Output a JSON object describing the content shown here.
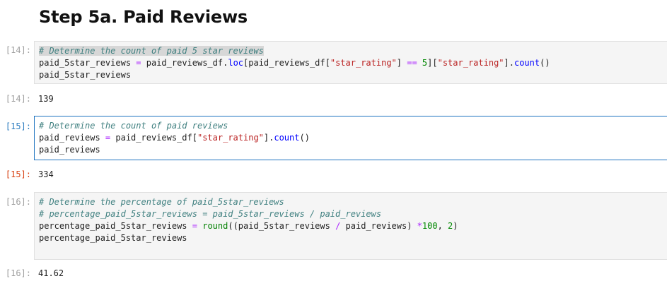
{
  "heading": "Step 5a. Paid Reviews",
  "cells": [
    {
      "in_prompt": "[14]:",
      "code": {
        "l1_comment": "# Determine the count of paid 5 star reviews",
        "l2_a": "paid_5star_reviews ",
        "l2_eq": "=",
        "l2_b": " paid_reviews_df.",
        "l2_loc": "loc",
        "l2_c": "[paid_reviews_df[",
        "l2_str1": "\"star_rating\"",
        "l2_d": "] ",
        "l2_eqeq": "==",
        "l2_e": " ",
        "l2_num": "5",
        "l2_f": "][",
        "l2_str2": "\"star_rating\"",
        "l2_g": "].",
        "l2_count": "count",
        "l2_h": "()",
        "l3": "paid_5star_reviews"
      },
      "out_prompt": "[14]:",
      "output": "139"
    },
    {
      "in_prompt": "[15]:",
      "code": {
        "l1_comment": "# Determine the count of paid reviews",
        "l2_a": "paid_reviews ",
        "l2_eq": "=",
        "l2_b": " paid_reviews_df[",
        "l2_str": "\"star_rating\"",
        "l2_c": "].",
        "l2_count": "count",
        "l2_d": "()",
        "l3": "paid_reviews"
      },
      "out_prompt": "[15]:",
      "output": "334"
    },
    {
      "in_prompt": "[16]:",
      "code": {
        "l1_comment": "# Determine the percentage of paid_5star_reviews",
        "l2_comment": "# percentage_paid_5star_reviews = paid_5star_reviews / paid_reviews",
        "l3_a": "percentage_paid_5star_reviews ",
        "l3_eq": "=",
        "l3_sp": " ",
        "l3_round": "round",
        "l3_b": "((paid_5star_reviews ",
        "l3_div": "/",
        "l3_c": " paid_reviews) ",
        "l3_mul": "*",
        "l3_n100": "100",
        "l3_d": ", ",
        "l3_n2": "2",
        "l3_e": ")",
        "l4": "percentage_paid_5star_reviews"
      },
      "out_prompt": "[16]:",
      "output": "41.62"
    }
  ]
}
